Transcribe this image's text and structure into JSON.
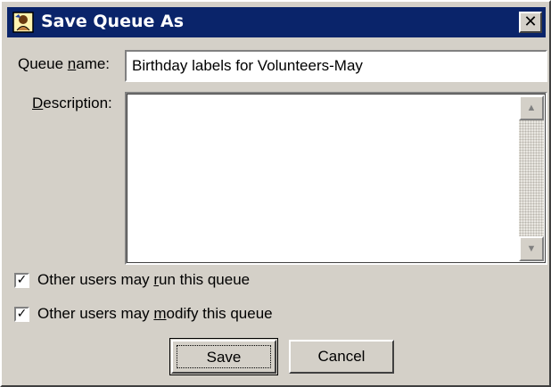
{
  "window": {
    "title": "Save Queue As",
    "close_glyph": "✕",
    "icon": "queue-app-icon"
  },
  "form": {
    "name_label_pre": "Queue ",
    "name_label_u": "n",
    "name_label_post": "ame:",
    "name_value": "Birthday labels for Volunteers-May",
    "desc_label_u": "D",
    "desc_label_post": "escription:",
    "desc_value": ""
  },
  "options": {
    "run": {
      "pre": "Other users may ",
      "u": "r",
      "post": "un this queue",
      "checked": true,
      "check_glyph": "✓"
    },
    "modify": {
      "pre": "Other users may ",
      "u": "m",
      "post": "odify this queue",
      "checked": true,
      "check_glyph": "✓"
    }
  },
  "buttons": {
    "save": "Save",
    "cancel": "Cancel"
  },
  "scrollbar": {
    "up": "▲",
    "down": "▼"
  },
  "colors": {
    "titlebar": "#0a246a",
    "face": "#d4d0c8"
  }
}
